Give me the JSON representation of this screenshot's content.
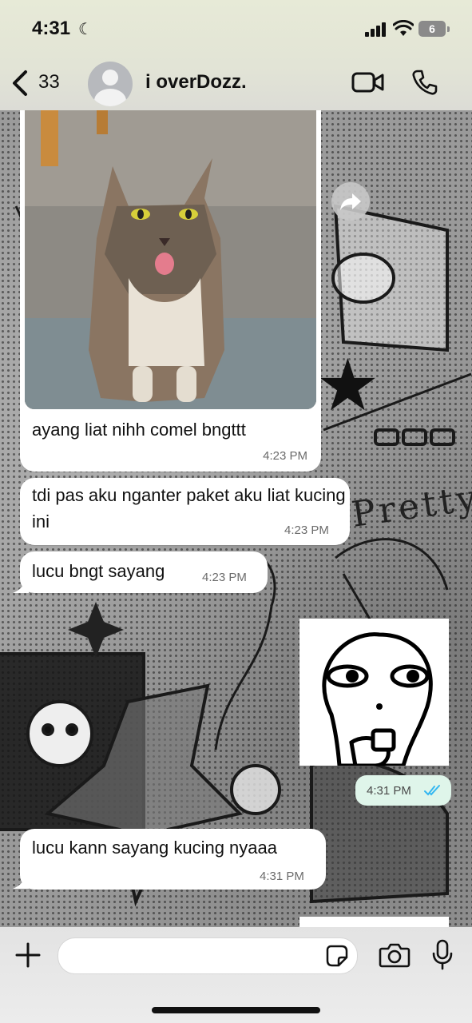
{
  "status_bar": {
    "time": "4:31",
    "battery": "6"
  },
  "header": {
    "back_count": "33",
    "contact_name": "i overDozz."
  },
  "messages": [
    {
      "type": "image",
      "direction": "incoming",
      "caption": "ayang liat nihh comel bngttt",
      "time": "4:23 PM"
    },
    {
      "type": "text",
      "direction": "incoming",
      "text": "tdi pas aku nganter paket aku liat kucing ini",
      "time": "4:23 PM"
    },
    {
      "type": "text",
      "direction": "incoming",
      "text": "lucu bngt sayang",
      "time": "4:23 PM"
    },
    {
      "type": "sticker",
      "direction": "outgoing",
      "time": "4:31 PM",
      "status": "read"
    },
    {
      "type": "text",
      "direction": "incoming",
      "text": "lucu kann sayang kucing nyaaa",
      "time": "4:31 PM"
    }
  ],
  "icons": {
    "back": "chevron-left-icon",
    "video": "video-camera-icon",
    "call": "phone-icon",
    "forward": "forward-icon",
    "attach": "plus-icon",
    "sticker": "sticker-icon",
    "camera": "camera-icon",
    "mic": "microphone-icon",
    "read_receipt": "double-check-icon"
  },
  "colors": {
    "incoming_bubble": "#ffffff",
    "outgoing_bubble": "#dff5ea",
    "read_receipt": "#34b7f1",
    "header_bg": "#e4e6d6"
  }
}
